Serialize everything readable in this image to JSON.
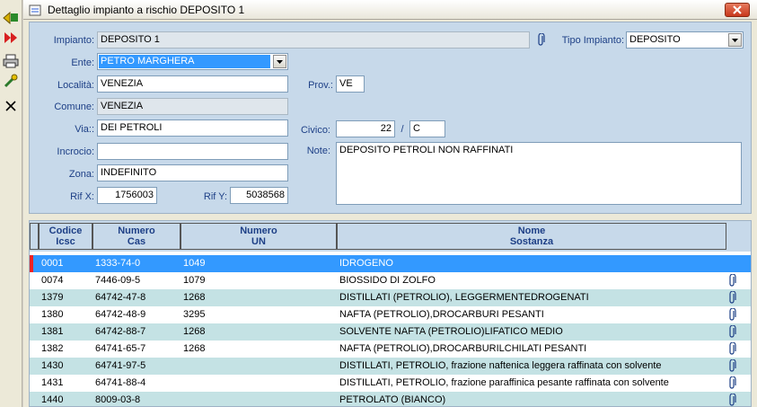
{
  "window": {
    "title": "Dettaglio impianto a rischio DEPOSITO 1"
  },
  "colors": {
    "selection": "#3399ff",
    "form_bg": "#c7d9ea",
    "row_alt": "#c4e2e4",
    "label": "#1d3f86",
    "marker": "#ee2222"
  },
  "toolbar": {
    "items": [
      {
        "name": "back-icon"
      },
      {
        "name": "fast-forward-icon"
      },
      {
        "name": "print-icon"
      },
      {
        "name": "tools-icon"
      },
      {
        "name": "close-x-icon"
      }
    ]
  },
  "form": {
    "impianto_label": "Impianto:",
    "impianto_value": "DEPOSITO 1",
    "tipo_label": "Tipo Impianto:",
    "tipo_value": "DEPOSITO",
    "ente_label": "Ente:",
    "ente_value": "PETRO MARGHERA",
    "localita_label": "Località:",
    "localita_value": "VENEZIA",
    "prov_label": "Prov.:",
    "prov_value": "VE",
    "comune_label": "Comune:",
    "comune_value": "VENEZIA",
    "via_label": "Via::",
    "via_value": "DEI PETROLI",
    "civico_label": "Civico:",
    "civico_value": "22",
    "civico_sep": "/",
    "civico_suffix": "C",
    "incrocio_label": "Incrocio:",
    "incrocio_value": "",
    "note_label": "Note:",
    "note_value": "DEPOSITO PETROLI NON RAFFINATI",
    "zona_label": "Zona:",
    "zona_value": "INDEFINITO",
    "rifx_label": "Rif X:",
    "rifx_value": "1756003",
    "rify_label": "Rif Y:",
    "rify_value": "5038568"
  },
  "grid": {
    "headers": [
      {
        "line1": "Codice",
        "line2": "Icsc"
      },
      {
        "line1": "Numero",
        "line2": "Cas"
      },
      {
        "line1": "Numero",
        "line2": "UN"
      },
      {
        "line1": "Nome",
        "line2": "Sostanza"
      }
    ],
    "rows": [
      {
        "code": "0001",
        "cas": "1333-74-0",
        "un": "1049",
        "name": "IDROGENO",
        "selected": true,
        "attach": false
      },
      {
        "code": "0074",
        "cas": "7446-09-5",
        "un": "1079",
        "name": "BIOSSIDO DI ZOLFO",
        "selected": false,
        "attach": true
      },
      {
        "code": "1379",
        "cas": "64742-47-8",
        "un": "1268",
        "name": "DISTILLATI (PETROLIO), LEGGERMENTEDROGENATI",
        "selected": false,
        "attach": true
      },
      {
        "code": "1380",
        "cas": "64742-48-9",
        "un": "3295",
        "name": "NAFTA (PETROLIO),DROCARBURI PESANTI",
        "selected": false,
        "attach": true
      },
      {
        "code": "1381",
        "cas": "64742-88-7",
        "un": "1268",
        "name": "SOLVENTE NAFTA (PETROLIO)LIFATICO MEDIO",
        "selected": false,
        "attach": true
      },
      {
        "code": "1382",
        "cas": "64741-65-7",
        "un": "1268",
        "name": "NAFTA (PETROLIO),DROCARBURILCHILATI PESANTI",
        "selected": false,
        "attach": true
      },
      {
        "code": "1430",
        "cas": "64741-97-5",
        "un": "",
        "name": "DISTILLATI, PETROLIO, frazione naftenica leggera raffinata con solvente",
        "selected": false,
        "attach": true
      },
      {
        "code": "1431",
        "cas": "64741-88-4",
        "un": "",
        "name": "DISTILLATI, PETROLIO, frazione paraffinica pesante raffinata con solvente",
        "selected": false,
        "attach": true
      },
      {
        "code": "1440",
        "cas": "8009-03-8",
        "un": "",
        "name": "PETROLATO (BIANCO)",
        "selected": false,
        "attach": true
      }
    ]
  }
}
